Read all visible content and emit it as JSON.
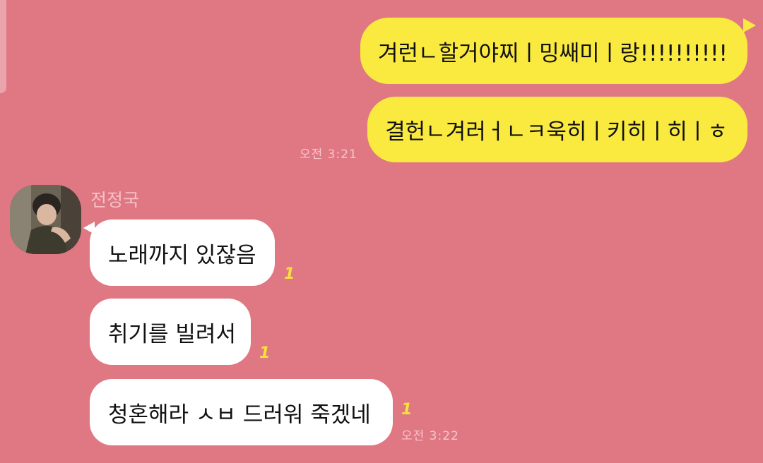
{
  "messages_mine": [
    {
      "text": "겨런ㄴ할거야찌ㅣ밍쌔미ㅣ랑!!!!!!!!!!"
    },
    {
      "text": "결헌ㄴ겨러ㅓㄴㅋ욱히ㅣ키히ㅣ히ㅣㅎ"
    }
  ],
  "mine_time": "오전 3:21",
  "sender": {
    "name": "전정국"
  },
  "messages_theirs": [
    {
      "text": "노래까지 있잖음",
      "read": "1"
    },
    {
      "text": "취기를 빌려서",
      "read": "1"
    },
    {
      "text": "청혼해라 ㅅㅂ 드러워 죽겠네",
      "read": "1"
    }
  ],
  "theirs_time": "오전 3:22",
  "colors": {
    "background": "#E07884",
    "mine_bubble": "#FAEA40",
    "theirs_bubble": "#FFFFFF",
    "read_mark": "#F5E23A",
    "timestamp": "#F6C6CC"
  }
}
